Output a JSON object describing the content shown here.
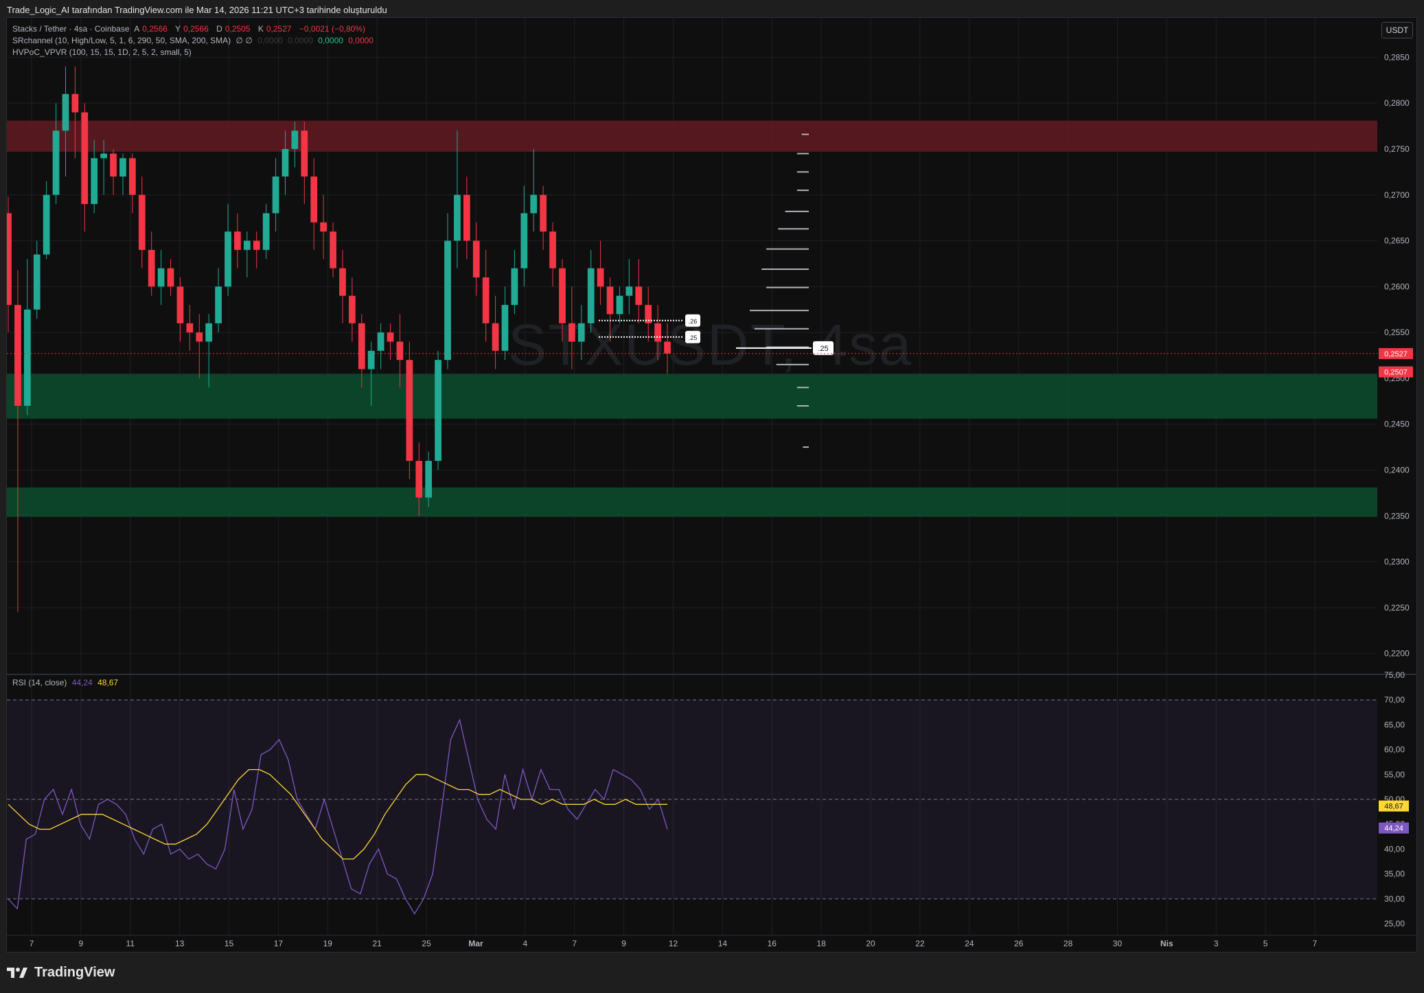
{
  "header": {
    "title": "Trade_Logic_AI tarafından TradingView.com ile Mar 14, 2026 11:21 UTC+3 tarihinde oluşturuldu"
  },
  "legend": {
    "symbol": "Stacks / Tether · 4sa · Coinbase",
    "o_label": "A",
    "o_value": "0,2566",
    "h_label": "Y",
    "h_value": "0,2566",
    "l_label": "D",
    "l_value": "0,2505",
    "c_label": "K",
    "c_value": "0,2527",
    "change": "−0,0021 (−0,80%)",
    "sr_name": "SRchannel (10, High/Low, 5, 1, 6, 290, 50, SMA, 200, SMA)",
    "sr_symbols": "∅ ∅",
    "sr_v1": "0,0000",
    "sr_v2": "0,0000",
    "sr_v3": "0,0000",
    "sr_v4": "0,0000",
    "hvpoc_name": "HVPoC_VPVR (100, 15, 15, 1D, 2, 5, 2, small, 5)",
    "rsi_name": "RSI (14, close)",
    "rsi_value": "44,24",
    "rsi_ma_value": "48,67"
  },
  "watermark": "STXUSDT, 4sa",
  "unit_button": "USDT",
  "brand": "TradingView",
  "colors": {
    "up": "#22ab94",
    "down": "#f23645",
    "rsi": "#7e57c2",
    "rsi_ma": "#fdd835",
    "resistance_zone": "#5c1a20",
    "support_zone": "#0b4a2c",
    "grid": "#1e2026"
  },
  "chart_data": [
    {
      "type": "candlestick",
      "title": "Stacks / Tether · 4sa · Coinbase",
      "x_ticks": [
        "7",
        "9",
        "11",
        "13",
        "15",
        "17",
        "19",
        "21",
        "25",
        "Mar",
        "4",
        "7",
        "9",
        "12",
        "14",
        "16",
        "18",
        "20",
        "22",
        "24",
        "26",
        "28",
        "30",
        "Nis",
        "3",
        "5",
        "7"
      ],
      "y_ticks": [
        "0,2850",
        "0,2800",
        "0,2750",
        "0,2700",
        "0,2650",
        "0,2600",
        "0,2550",
        "0,2500",
        "0,2450",
        "0,2400",
        "0,2350",
        "0,2300",
        "0,2250",
        "0,2200"
      ],
      "ylim": [
        0.2178,
        0.2893
      ],
      "last_price": "0,2527",
      "support_label": "0,2507",
      "zones": [
        {
          "kind": "resistance",
          "from": 0.2747,
          "to": 0.2781
        },
        {
          "kind": "support",
          "from": 0.2456,
          "to": 0.2505
        },
        {
          "kind": "support",
          "from": 0.2349,
          "to": 0.2381
        }
      ],
      "level_tags": [
        ".26",
        ".25",
        ".25"
      ],
      "vpvr_levels": [
        {
          "price": 0.2766,
          "len": 0.12
        },
        {
          "price": 0.2745,
          "len": 0.2
        },
        {
          "price": 0.2725,
          "len": 0.2
        },
        {
          "price": 0.2705,
          "len": 0.2
        },
        {
          "price": 0.2682,
          "len": 0.4
        },
        {
          "price": 0.2663,
          "len": 0.52
        },
        {
          "price": 0.2641,
          "len": 0.72
        },
        {
          "price": 0.2619,
          "len": 0.8
        },
        {
          "price": 0.2599,
          "len": 0.72
        },
        {
          "price": 0.2574,
          "len": 1.0
        },
        {
          "price": 0.2554,
          "len": 0.92
        },
        {
          "price": 0.2534,
          "len": 0.72
        },
        {
          "price": 0.2515,
          "len": 0.55
        },
        {
          "price": 0.249,
          "len": 0.2
        },
        {
          "price": 0.247,
          "len": 0.2
        },
        {
          "price": 0.2425,
          "len": 0.1
        }
      ],
      "candles": [
        [
          0.268,
          0.2698,
          0.255,
          0.258
        ],
        [
          0.258,
          0.2618,
          0.2245,
          0.247
        ],
        [
          0.247,
          0.263,
          0.246,
          0.2575
        ],
        [
          0.2575,
          0.265,
          0.2565,
          0.2635
        ],
        [
          0.2635,
          0.2715,
          0.263,
          0.27
        ],
        [
          0.27,
          0.28,
          0.269,
          0.277
        ],
        [
          0.277,
          0.284,
          0.272,
          0.281
        ],
        [
          0.281,
          0.284,
          0.274,
          0.279
        ],
        [
          0.279,
          0.28,
          0.266,
          0.269
        ],
        [
          0.269,
          0.276,
          0.268,
          0.274
        ],
        [
          0.274,
          0.276,
          0.27,
          0.2745
        ],
        [
          0.2745,
          0.275,
          0.27,
          0.272
        ],
        [
          0.272,
          0.2745,
          0.27,
          0.274
        ],
        [
          0.274,
          0.2745,
          0.268,
          0.27
        ],
        [
          0.27,
          0.272,
          0.262,
          0.264
        ],
        [
          0.264,
          0.266,
          0.259,
          0.26
        ],
        [
          0.26,
          0.264,
          0.258,
          0.262
        ],
        [
          0.262,
          0.263,
          0.259,
          0.26
        ],
        [
          0.26,
          0.261,
          0.254,
          0.256
        ],
        [
          0.256,
          0.258,
          0.253,
          0.255
        ],
        [
          0.255,
          0.257,
          0.25,
          0.254
        ],
        [
          0.254,
          0.257,
          0.249,
          0.256
        ],
        [
          0.256,
          0.262,
          0.255,
          0.26
        ],
        [
          0.26,
          0.269,
          0.259,
          0.266
        ],
        [
          0.266,
          0.268,
          0.262,
          0.264
        ],
        [
          0.264,
          0.266,
          0.261,
          0.265
        ],
        [
          0.265,
          0.266,
          0.262,
          0.264
        ],
        [
          0.264,
          0.269,
          0.263,
          0.268
        ],
        [
          0.268,
          0.274,
          0.266,
          0.272
        ],
        [
          0.272,
          0.277,
          0.27,
          0.275
        ],
        [
          0.275,
          0.278,
          0.273,
          0.277
        ],
        [
          0.277,
          0.278,
          0.269,
          0.272
        ],
        [
          0.272,
          0.274,
          0.264,
          0.267
        ],
        [
          0.267,
          0.27,
          0.263,
          0.266
        ],
        [
          0.266,
          0.267,
          0.261,
          0.262
        ],
        [
          0.262,
          0.264,
          0.256,
          0.259
        ],
        [
          0.259,
          0.261,
          0.254,
          0.256
        ],
        [
          0.256,
          0.257,
          0.249,
          0.251
        ],
        [
          0.251,
          0.254,
          0.247,
          0.253
        ],
        [
          0.253,
          0.256,
          0.251,
          0.255
        ],
        [
          0.255,
          0.256,
          0.252,
          0.254
        ],
        [
          0.254,
          0.257,
          0.249,
          0.252
        ],
        [
          0.252,
          0.254,
          0.239,
          0.241
        ],
        [
          0.241,
          0.243,
          0.235,
          0.237
        ],
        [
          0.237,
          0.242,
          0.236,
          0.241
        ],
        [
          0.241,
          0.253,
          0.24,
          0.252
        ],
        [
          0.252,
          0.268,
          0.251,
          0.265
        ],
        [
          0.265,
          0.277,
          0.262,
          0.27
        ],
        [
          0.27,
          0.272,
          0.263,
          0.265
        ],
        [
          0.265,
          0.267,
          0.259,
          0.261
        ],
        [
          0.261,
          0.264,
          0.254,
          0.256
        ],
        [
          0.256,
          0.259,
          0.251,
          0.253
        ],
        [
          0.253,
          0.26,
          0.252,
          0.258
        ],
        [
          0.258,
          0.264,
          0.257,
          0.262
        ],
        [
          0.262,
          0.271,
          0.26,
          0.268
        ],
        [
          0.268,
          0.275,
          0.266,
          0.27
        ],
        [
          0.27,
          0.271,
          0.264,
          0.266
        ],
        [
          0.266,
          0.267,
          0.26,
          0.262
        ],
        [
          0.262,
          0.263,
          0.254,
          0.256
        ],
        [
          0.256,
          0.26,
          0.251,
          0.254
        ],
        [
          0.254,
          0.258,
          0.252,
          0.256
        ],
        [
          0.256,
          0.264,
          0.255,
          0.262
        ],
        [
          0.262,
          0.265,
          0.258,
          0.26
        ],
        [
          0.26,
          0.261,
          0.254,
          0.257
        ],
        [
          0.257,
          0.26,
          0.256,
          0.259
        ],
        [
          0.259,
          0.263,
          0.257,
          0.26
        ],
        [
          0.26,
          0.263,
          0.256,
          0.258
        ],
        [
          0.258,
          0.26,
          0.254,
          0.256
        ],
        [
          0.256,
          0.258,
          0.252,
          0.254
        ],
        [
          0.254,
          0.256,
          0.2505,
          0.2527
        ]
      ]
    },
    {
      "type": "line",
      "title": "RSI (14, close)",
      "y_ticks": [
        "75,00",
        "70,00",
        "65,00",
        "60,00",
        "55,00",
        "50,00",
        "45,00",
        "40,00",
        "35,00",
        "30,00",
        "25,00"
      ],
      "ylim": [
        22.8,
        75.0
      ],
      "band": [
        30,
        70
      ],
      "midline": 50,
      "series": [
        {
          "name": "RSI",
          "values": [
            30,
            28,
            42,
            43,
            50,
            52,
            47,
            52,
            45,
            42,
            49,
            50,
            49,
            47,
            42,
            39,
            44,
            45,
            39,
            40,
            38,
            39,
            37,
            36,
            40,
            52,
            44,
            48,
            59,
            60,
            62,
            58,
            50,
            47,
            44,
            50,
            44,
            38,
            32,
            31,
            37,
            40,
            35,
            34,
            30,
            27,
            30,
            35,
            48,
            62,
            66,
            58,
            50,
            46,
            44,
            55,
            48,
            56,
            50,
            56,
            52,
            52,
            48,
            46,
            49,
            52,
            50,
            56,
            55,
            54,
            52,
            48,
            50,
            44
          ]
        },
        {
          "name": "MA",
          "values": [
            49,
            47,
            45,
            44,
            44,
            45,
            46,
            47,
            47,
            47,
            46,
            45,
            44,
            43,
            42,
            41,
            41,
            42,
            43,
            45,
            48,
            51,
            54,
            56,
            56,
            55,
            53,
            51,
            48,
            45,
            42,
            40,
            38,
            38,
            40,
            43,
            47,
            50,
            53,
            55,
            55,
            54,
            53,
            52,
            52,
            51,
            51,
            52,
            51,
            50,
            50,
            49,
            50,
            49,
            49,
            49,
            50,
            49,
            49,
            50,
            49,
            49,
            49,
            49
          ]
        }
      ]
    }
  ]
}
